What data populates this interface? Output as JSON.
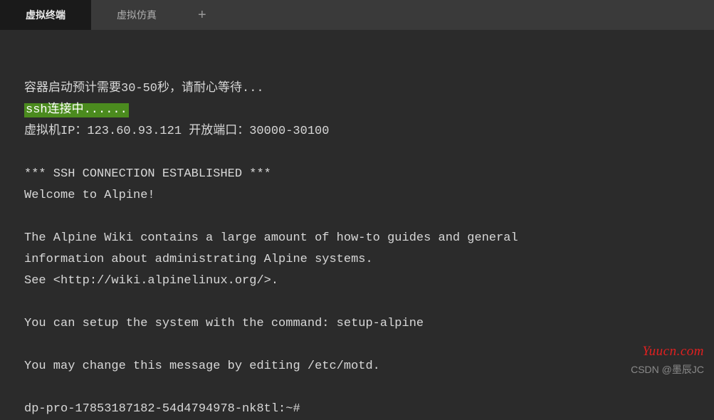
{
  "tabs": {
    "active": "虚拟终端",
    "inactive": "虚拟仿真",
    "add": "+"
  },
  "terminal": {
    "line1": "容器启动预计需要30-50秒，请耐心等待...",
    "highlight": "ssh连接中......",
    "line3": "虚拟机IP：123.60.93.121 开放端口：30000-30100",
    "blank1": "",
    "line5": "*** SSH CONNECTION ESTABLISHED ***",
    "line6": "Welcome to Alpine!",
    "blank2": "",
    "line8": "The Alpine Wiki contains a large amount of how-to guides and general",
    "line9": "information about administrating Alpine systems.",
    "line10": "See <http://wiki.alpinelinux.org/>.",
    "blank3": "",
    "line12": "You can setup the system with the command: setup-alpine",
    "blank4": "",
    "line14": "You may change this message by editing /etc/motd.",
    "blank5": "",
    "prompt": "dp-pro-17853187182-54d4794978-nk8tl:~#"
  },
  "watermarks": {
    "right": "Yuucn.com",
    "bottom": "CSDN @墨辰JC"
  }
}
